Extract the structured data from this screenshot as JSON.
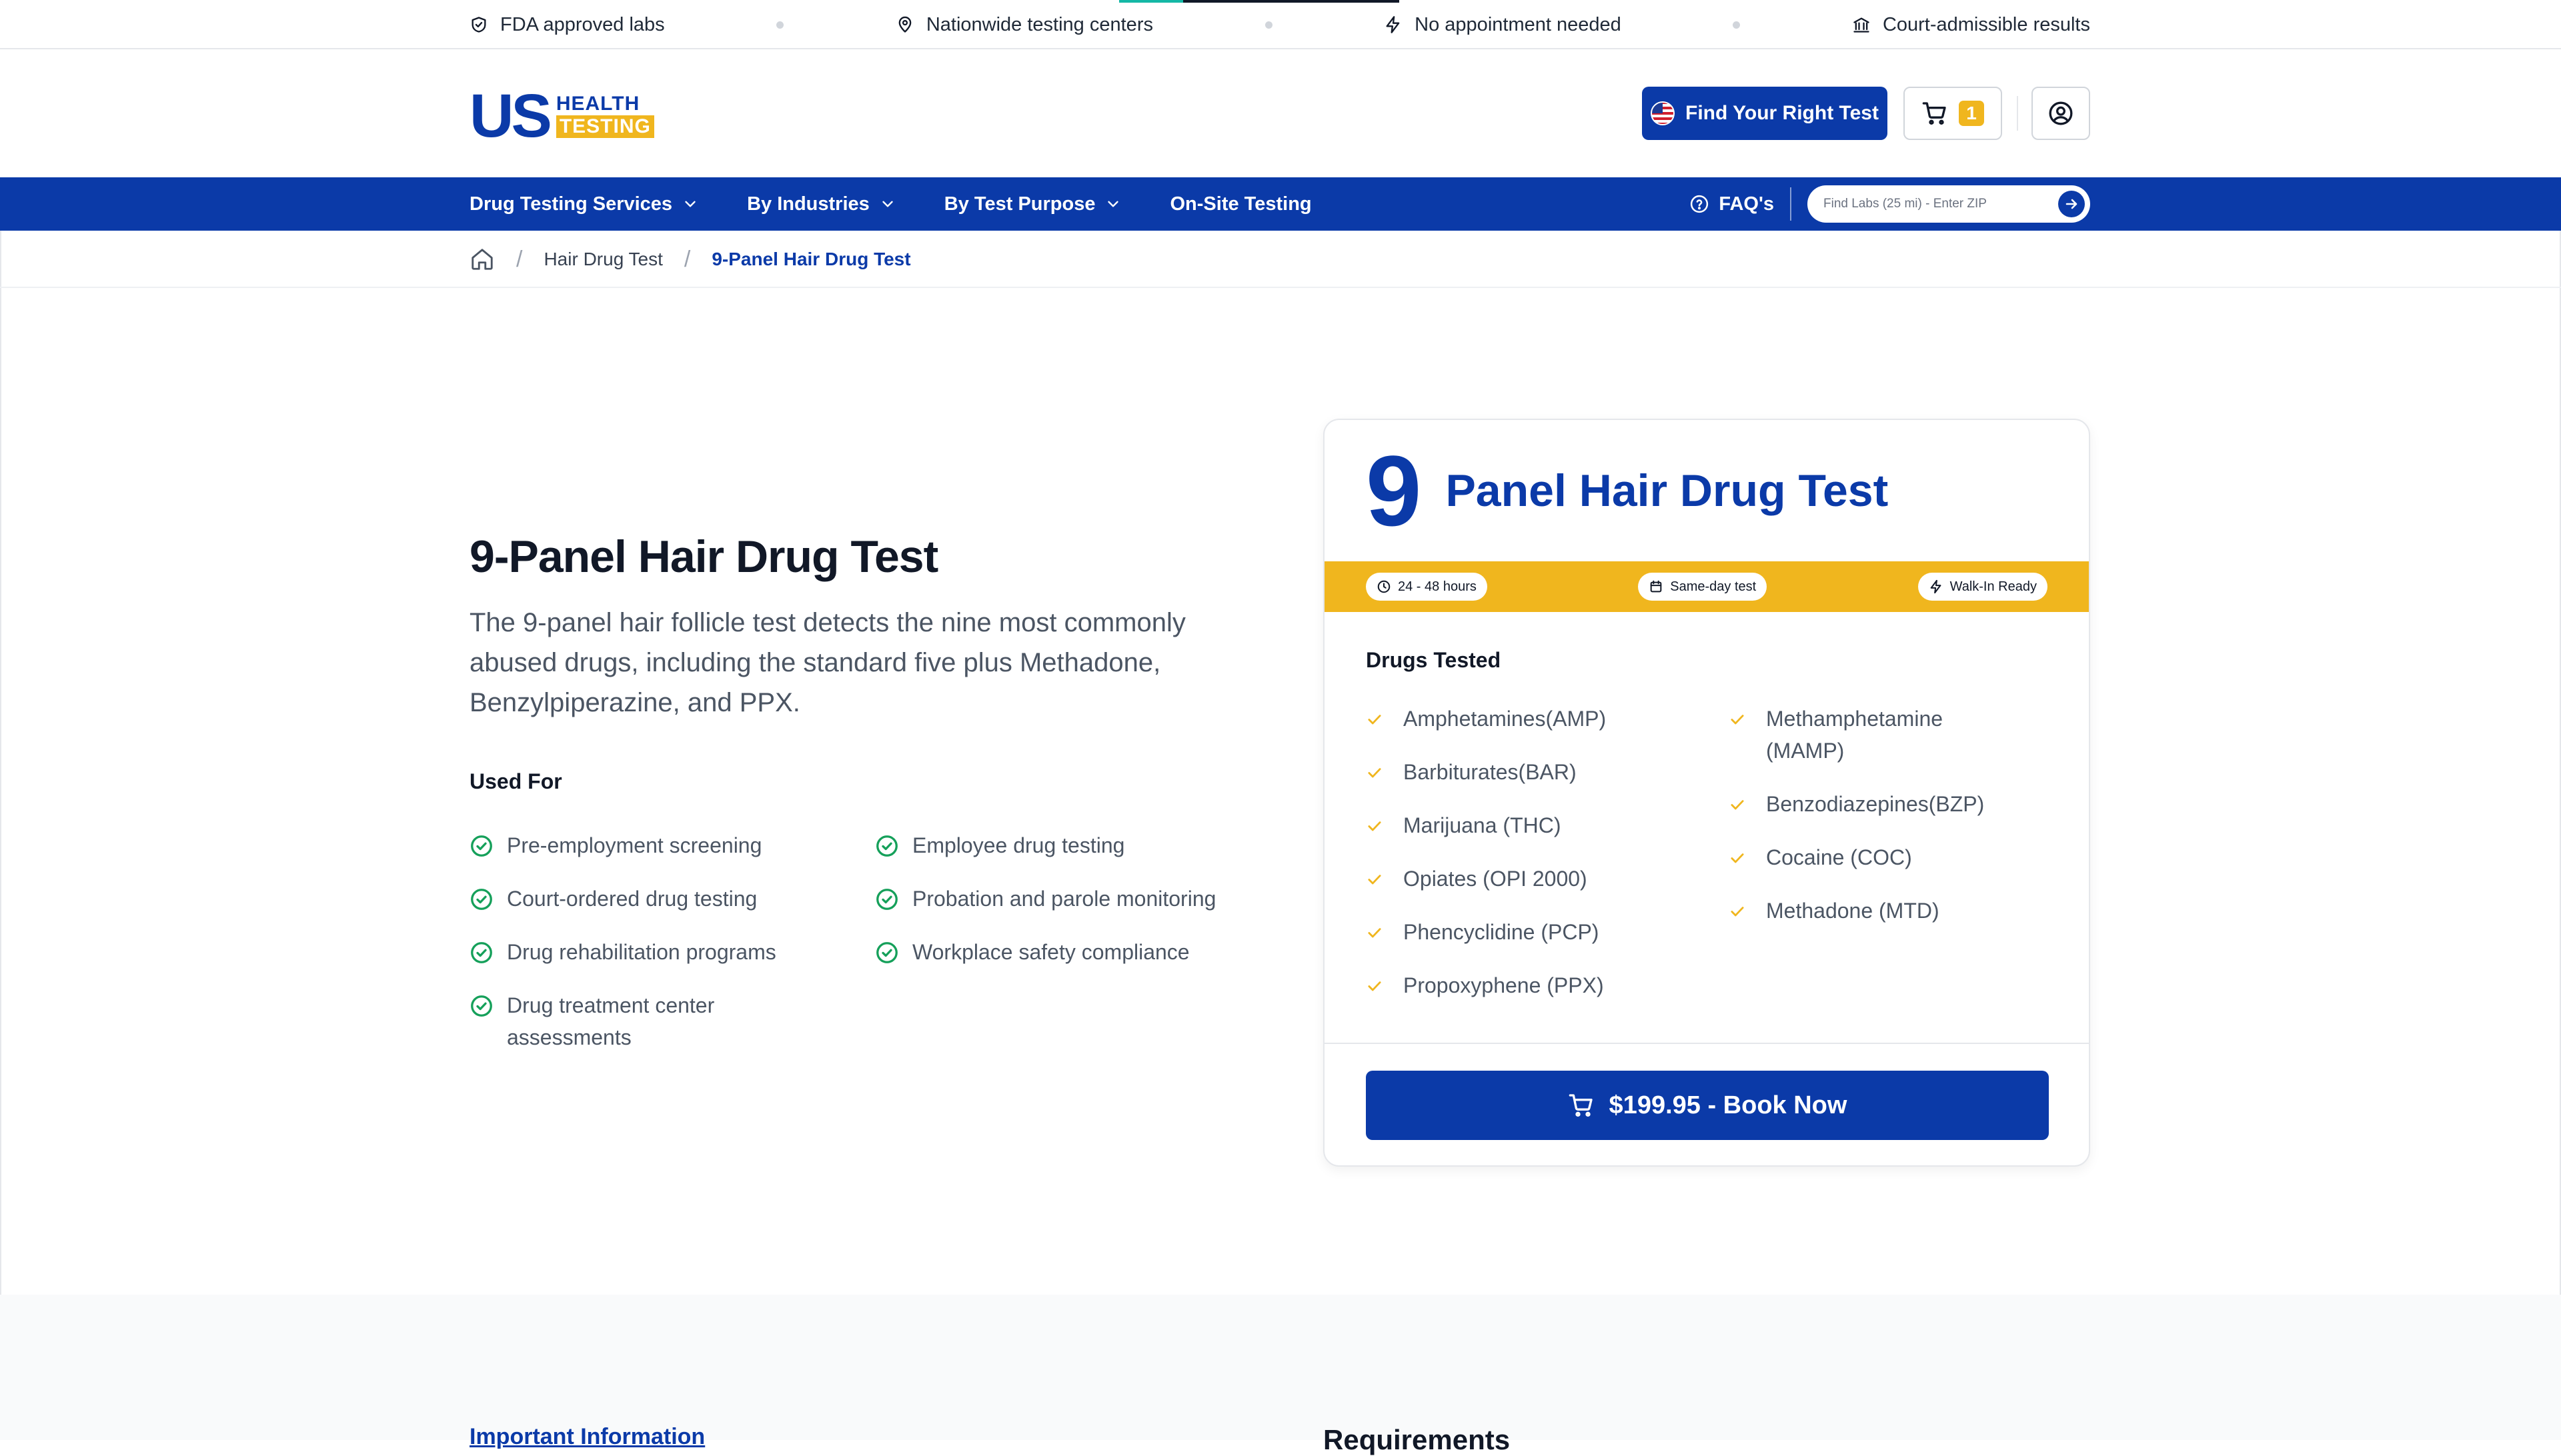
{
  "topbar": {
    "items": [
      {
        "icon": "shield-check-icon",
        "label": "FDA approved labs"
      },
      {
        "icon": "map-pin-icon",
        "label": "Nationwide testing centers"
      },
      {
        "icon": "lightning-icon",
        "label": "No appointment needed"
      },
      {
        "icon": "courthouse-icon",
        "label": "Court-admissible results"
      }
    ]
  },
  "header": {
    "logo_us": "US",
    "logo_health": "HEALTH",
    "logo_testing": "TESTING",
    "find_test_label": "Find Your Right Test",
    "cart_count": "1"
  },
  "nav": {
    "items": [
      {
        "label": "Drug Testing Services",
        "dropdown": true
      },
      {
        "label": "By Industries",
        "dropdown": true
      },
      {
        "label": "By Test Purpose",
        "dropdown": true
      },
      {
        "label": "On-Site Testing",
        "dropdown": false
      }
    ],
    "faq_label": "FAQ's",
    "zip_placeholder": "Find Labs (25 mi) - Enter ZIP"
  },
  "breadcrumb": {
    "items": [
      "Hair Drug Test",
      "9-Panel Hair Drug Test"
    ]
  },
  "main": {
    "title": "9-Panel Hair Drug Test",
    "description": "The 9-panel hair follicle test detects the nine most commonly abused drugs, including the standard five plus Methadone, Benzylpiperazine, and PPX.",
    "used_for_heading": "Used For",
    "used_for": [
      "Pre-employment screening",
      "Employee drug testing",
      "Court-ordered drug testing",
      "Probation and parole monitoring",
      "Drug rehabilitation programs",
      "Workplace safety compliance",
      "Drug treatment center assessments"
    ]
  },
  "card": {
    "number": "9",
    "title": "Panel Hair Drug Test",
    "badges": [
      {
        "icon": "clock-icon",
        "label": "24 - 48 hours"
      },
      {
        "icon": "calendar-icon",
        "label": "Same-day test"
      },
      {
        "icon": "lightning-icon",
        "label": "Walk-In Ready"
      }
    ],
    "drugs_heading": "Drugs Tested",
    "drugs_col1": [
      "Amphetamines(AMP)",
      "Barbiturates(BAR)",
      "Marijuana (THC)",
      "Opiates (OPI 2000)",
      "Phencyclidine (PCP)",
      "Propoxyphene (PPX)"
    ],
    "drugs_col2": [
      "Methamphetamine (MAMP)",
      "Benzodiazepines(BZP)",
      "Cocaine (COC)",
      "Methadone (MTD)"
    ],
    "book_label": "$199.95 - Book Now"
  },
  "bottom": {
    "important_info": "Important Information",
    "requirements": "Requirements"
  },
  "colors": {
    "brand_blue": "#0b3aa8",
    "accent_yellow": "#f0b61e",
    "check_green": "#15a05a"
  }
}
